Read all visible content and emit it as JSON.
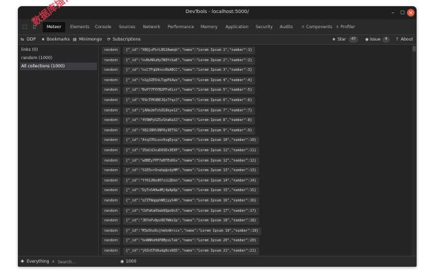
{
  "window": {
    "title": "DevTools - localhost:5000/"
  },
  "tabs": [
    "Meteor",
    "Elements",
    "Console",
    "Sources",
    "Network",
    "Performance",
    "Memory",
    "Application",
    "Security",
    "Audits",
    "Components",
    "Profiler"
  ],
  "toolbar": {
    "ddp": "DDP",
    "bookmarks": "Bookmarks",
    "minimongo": "Minimongo",
    "subscriptions": "Subscriptions",
    "star": "Star",
    "star_count": "47",
    "issue": "Issue",
    "issue_count": "4",
    "about": "About"
  },
  "sidebar": {
    "items": [
      {
        "label": "links (0)"
      },
      {
        "label": "random (1000)"
      },
      {
        "label": "All collections (1000)"
      }
    ]
  },
  "rows_collection": "random",
  "docs": [
    "{\"_id\":\"X8QjuFbrL862Awmqh\",\"name\":\"Lorem Ipsum 1\",\"number\":1}",
    "{\"_id\":\"nvNvN6uHy7N0YxSaE\",\"name\":\"Lorem Ipsum 2\",\"number\":2}",
    "{\"_id\":\"ncC7FqGHnvcRbABCC\",\"name\":\"Lorem Ipsum 3\",\"number\":3}",
    "{\"_id\":\"o1g3ZE5nLTqpPkXwx\",\"name\":\"Lorem Ipsum 4\",\"number\":4}",
    "{\"_id\":\"BvP77FXYB2PFv6ixr\",\"name\":\"Lorem Ipsum 5\",\"number\":5}",
    "{\"_id\":\"E9cTPK9BEJQz7fqzJ\",\"name\":\"Lorem Ipsum 6\",\"number\":6}",
    "{\"_id\":\"jA8e2mTchZG9kye12\",\"name\":\"Lorem Ipsum 7\",\"number\":7}",
    "{\"_id\":\"4Y8WFpSZ5zShaKa3J\",\"name\":\"Lorem Ipsum 8\",\"number\":8}",
    "{\"_id\":\"X82J8R%3NP0y3ETSG\",\"name\":\"Lorem Ipsum 9\",\"number\":9}",
    "{\"_id\":\"Atq37Riuss9vgEycp\",\"name\":\"Lorem Ipsum 10\",\"number\":10}",
    "{\"_id\":\"Z5eCdJcuEASEx3EXP\",\"name\":\"Lorem Ipsum 11\",\"number\":11}",
    "{\"_id\":\"w8BEy7PF7eBTEnDGv\",\"name\":\"Lorem Ipsum 12\",\"number\":12}",
    "{\"_id\":\"S1E5orOcwhp@cdyHM\",\"name\":\"Lorem Ipsum 13\",\"number\":13}",
    "{\"_id\":\"ff612NzdH7ziLQDon\",\"name\":\"Lorem Ipsum 14\",\"number\":14}",
    "{\"_id\":\"DyTo5AHwdMj4pAp6p\",\"name\":\"Lorem Ipsum 15\",\"number\":15}",
    "{\"_id\":\"q7ZTWqpphWBjyyS4R\",\"name\":\"Lorem Ipsum 16\",\"number\":16}",
    "{\"_id\":\"CbFeKaRSwb8Qpo6n3\",\"name\":\"Lorem Ipsum 17\",\"number\":17}",
    "{\"_id\":\"JB7ePv8pz0D7WWz2p\",\"name\":\"Lorem Ipsum 18\",\"number\":18}",
    "{\"_id\":\"M3e5hz6cjhmbnWrccx\",\"name\":\"Lorem Ipsum 19\",\"number\":19}",
    "{\"_id\":\"boWNKeHdP8MpsLTak\",\"name\":\"Lorem Ipsum 20\",\"number\":20}",
    "{\"_id\":\"jRZo5ThRudg8cv6Q5\",\"name\":\"Lorem Ipsum 21\",\"number\":21}",
    "{\"_id\":\"Wz4o2hQy7yh0MnMfr\",\"name\":\"Lorem Ipsum 22\",\"number\":22}"
  ],
  "status": {
    "filter": "Everything",
    "search_placeholder": "Search...",
    "count": "1000"
  },
  "watermark": "数据库插件"
}
